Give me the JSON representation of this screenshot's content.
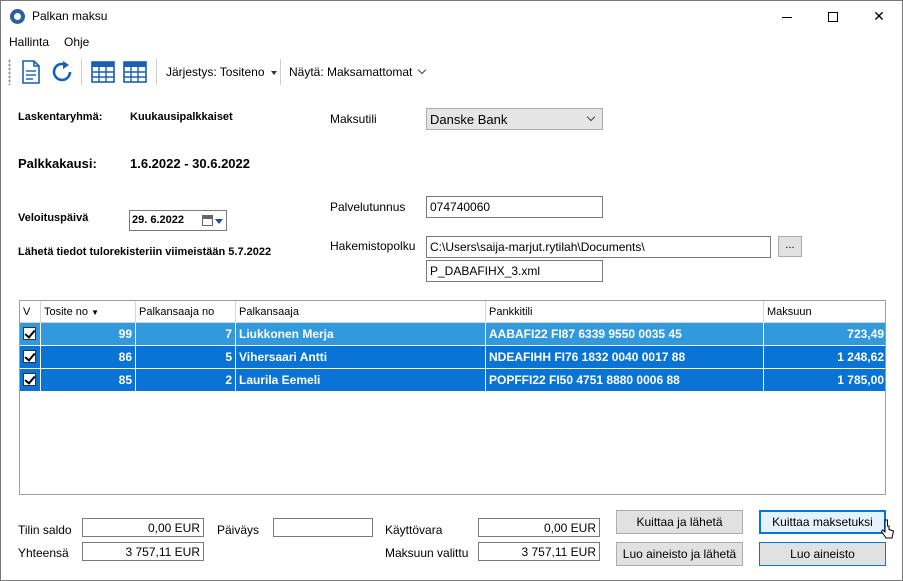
{
  "window": {
    "title": "Palkan maksu",
    "controls": {
      "minimize": "",
      "maximize": "",
      "close": "✕"
    }
  },
  "menu": {
    "items": [
      "Hallinta",
      "Ohje"
    ]
  },
  "toolbar": {
    "sort_label": "Järjestys: Tositeno",
    "show_label": "Näytä: Maksamattomat"
  },
  "form": {
    "group_label": "Laskentaryhmä:",
    "group_value": "Kuukausipalkkaiset",
    "period_label": "Palkkakausi:",
    "period_value": "1.6.2022 - 30.6.2022",
    "charge_date_label": "Veloituspäivä",
    "charge_date_value": "29.  6.2022",
    "notice": "Lähetä tiedot tulorekisteriin viimeistään 5.7.2022",
    "account_label": "Maksutili",
    "account_value": "Danske Bank",
    "service_id_label": "Palvelutunnus",
    "service_id_value": "074740060",
    "dir_label": "Hakemistopolku",
    "dir_value": "C:\\Users\\saija-marjut.rytilah\\Documents\\",
    "file_value": "P_DABAFIHX_3.xml",
    "browse_label": "..."
  },
  "grid": {
    "columns": [
      "V",
      "Tosite no",
      "Palkansaaja no",
      "Palkansaaja",
      "Pankkitili",
      "Maksuun"
    ],
    "rows": [
      {
        "tosite": "99",
        "no": "7",
        "name": "Liukkonen Merja",
        "account": "AABAFI22 FI87 6339 9550 0035 45",
        "amount": "723,49"
      },
      {
        "tosite": "86",
        "no": "5",
        "name": "Vihersaari Antti",
        "account": "NDEAFIHH FI76 1832 0040 0017 88",
        "amount": "1 248,62"
      },
      {
        "tosite": "85",
        "no": "2",
        "name": "Laurila Eemeli",
        "account": "POPFFI22 FI50 4751 8880 0006 88",
        "amount": "1 785,00"
      }
    ]
  },
  "footer": {
    "balance_label": "Tilin saldo",
    "balance_value": "0,00  EUR",
    "total_label": "Yhteensä",
    "total_value": "3 757,11  EUR",
    "date_label": "Päiväys",
    "date_value": "",
    "available_label": "Käyttövara",
    "available_value": "0,00  EUR",
    "selected_label": "Maksuun valittu",
    "selected_value": "3 757,11  EUR",
    "btn_ack_send": "Kuittaa ja lähetä",
    "btn_ack_payments": "Kuittaa maksetuksi",
    "btn_create_send": "Luo aineisto ja lähetä",
    "btn_create": "Luo aineisto"
  }
}
